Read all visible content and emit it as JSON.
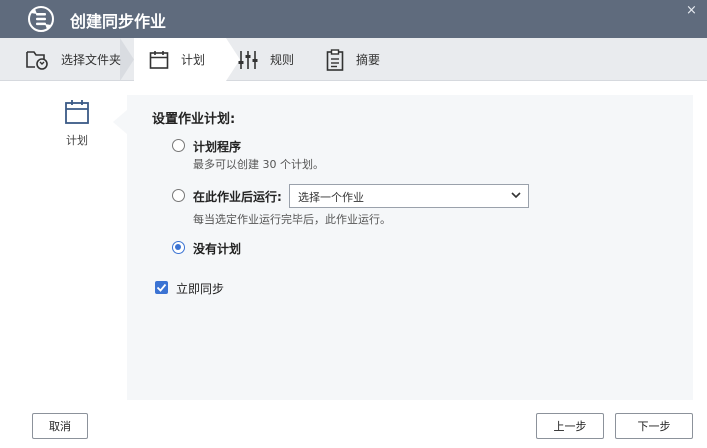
{
  "window": {
    "title": "创建同步作业",
    "close_glyph": "×"
  },
  "steps": [
    {
      "label": "选择文件夹",
      "icon": "folder-sync-icon"
    },
    {
      "label": "计划",
      "icon": "calendar-icon",
      "active": true
    },
    {
      "label": "规则",
      "icon": "sliders-icon"
    },
    {
      "label": "摘要",
      "icon": "clipboard-icon"
    }
  ],
  "side": {
    "label": "计划",
    "icon": "calendar-icon"
  },
  "schedule": {
    "title": "设置作业计划:",
    "option1": {
      "label": "计划程序",
      "hint": "最多可以创建 30 个计划。"
    },
    "option2": {
      "label": "在此作业后运行:",
      "select_value": "选择一个作业",
      "hint": "每当选定作业运行完毕后，此作业运行。"
    },
    "option3": {
      "label": "没有计划",
      "checked": true
    },
    "sync_now": {
      "label": "立即同步",
      "checked": true
    }
  },
  "buttons": {
    "cancel": "取消",
    "prev": "上一步",
    "next": "下一步"
  },
  "colors": {
    "titlebar": "#5f6b7d",
    "accent": "#3b73d3",
    "panel": "#f5f7f9"
  }
}
